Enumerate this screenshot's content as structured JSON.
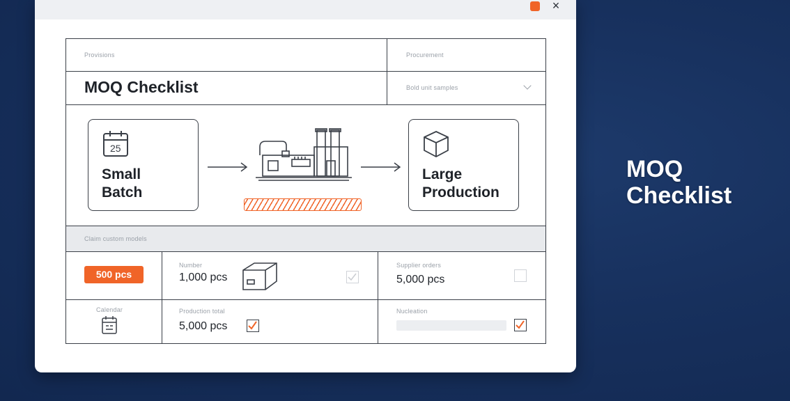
{
  "window": {
    "close_glyph": "×"
  },
  "header": {
    "left_caption": "Provisions",
    "right_caption": "Procurement",
    "title": "MOQ Checklist",
    "select_placeholder": "Bold unit samples"
  },
  "flow": {
    "start": {
      "date_number": "25",
      "label_line1": "Small",
      "label_line2": "Batch"
    },
    "end": {
      "label_line1": "Large",
      "label_line2": "Production"
    }
  },
  "section": {
    "label": "Claim custom models"
  },
  "grid": {
    "pill_label": "500 pcs",
    "cell_number_caption": "Number",
    "cell_number_value": "1,000 pcs",
    "cell_number_checked": false,
    "cell_supplier_caption": "Supplier orders",
    "cell_supplier_value": "5,000 pcs",
    "cell_supplier_checked": false,
    "calendar_caption": "Calendar",
    "cell_total_caption": "Production total",
    "cell_total_value": "5,000 pcs",
    "cell_total_checked": true,
    "cell_notes_caption": "Nucleation",
    "cell_notes_checked": true
  },
  "side": {
    "title_line1": "MOQ",
    "title_line2": "Checklist"
  },
  "colors": {
    "accent": "#f06428",
    "ink": "#3a3f47",
    "background": "#17305d"
  }
}
